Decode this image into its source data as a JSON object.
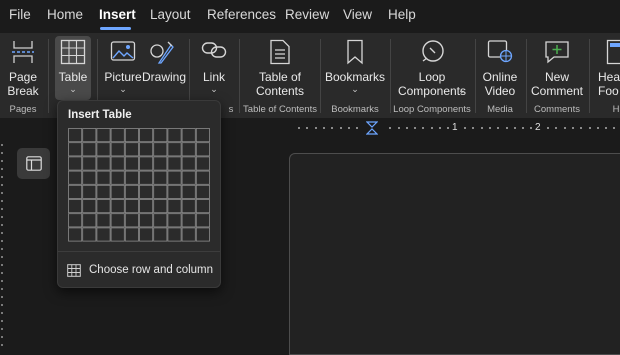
{
  "menu": {
    "items": [
      "File",
      "Home",
      "Insert",
      "Layout",
      "References",
      "Review",
      "View",
      "Help"
    ],
    "active": "Insert"
  },
  "ribbon": {
    "page_break": "Page\nBreak",
    "table": "Table",
    "picture": "Picture",
    "drawing": "Drawing",
    "link": "Link",
    "toc": "Table of\nContents",
    "bookmarks": "Bookmarks",
    "loop": "Loop\nComponents",
    "online_video": "Online\nVideo",
    "new_comment": "New\nComment",
    "header_footer": "Head\nFoo",
    "groups": {
      "pages": "Pages",
      "links_partial": "s",
      "toc": "Table of Contents",
      "bookmarks": "Bookmarks",
      "loop": "Loop Components",
      "media": "Media",
      "comments": "Comments",
      "hf_partial": "H"
    }
  },
  "ruler": {
    "marks": [
      "1",
      "2"
    ]
  },
  "insert_table": {
    "title": "Insert Table",
    "grid_cols": 10,
    "grid_rows": 8,
    "choose_label": "Choose row and column"
  },
  "colors": {
    "accent": "#6ea6ff",
    "background": "#1b1b1b",
    "ribbon": "#2a2a2a"
  }
}
